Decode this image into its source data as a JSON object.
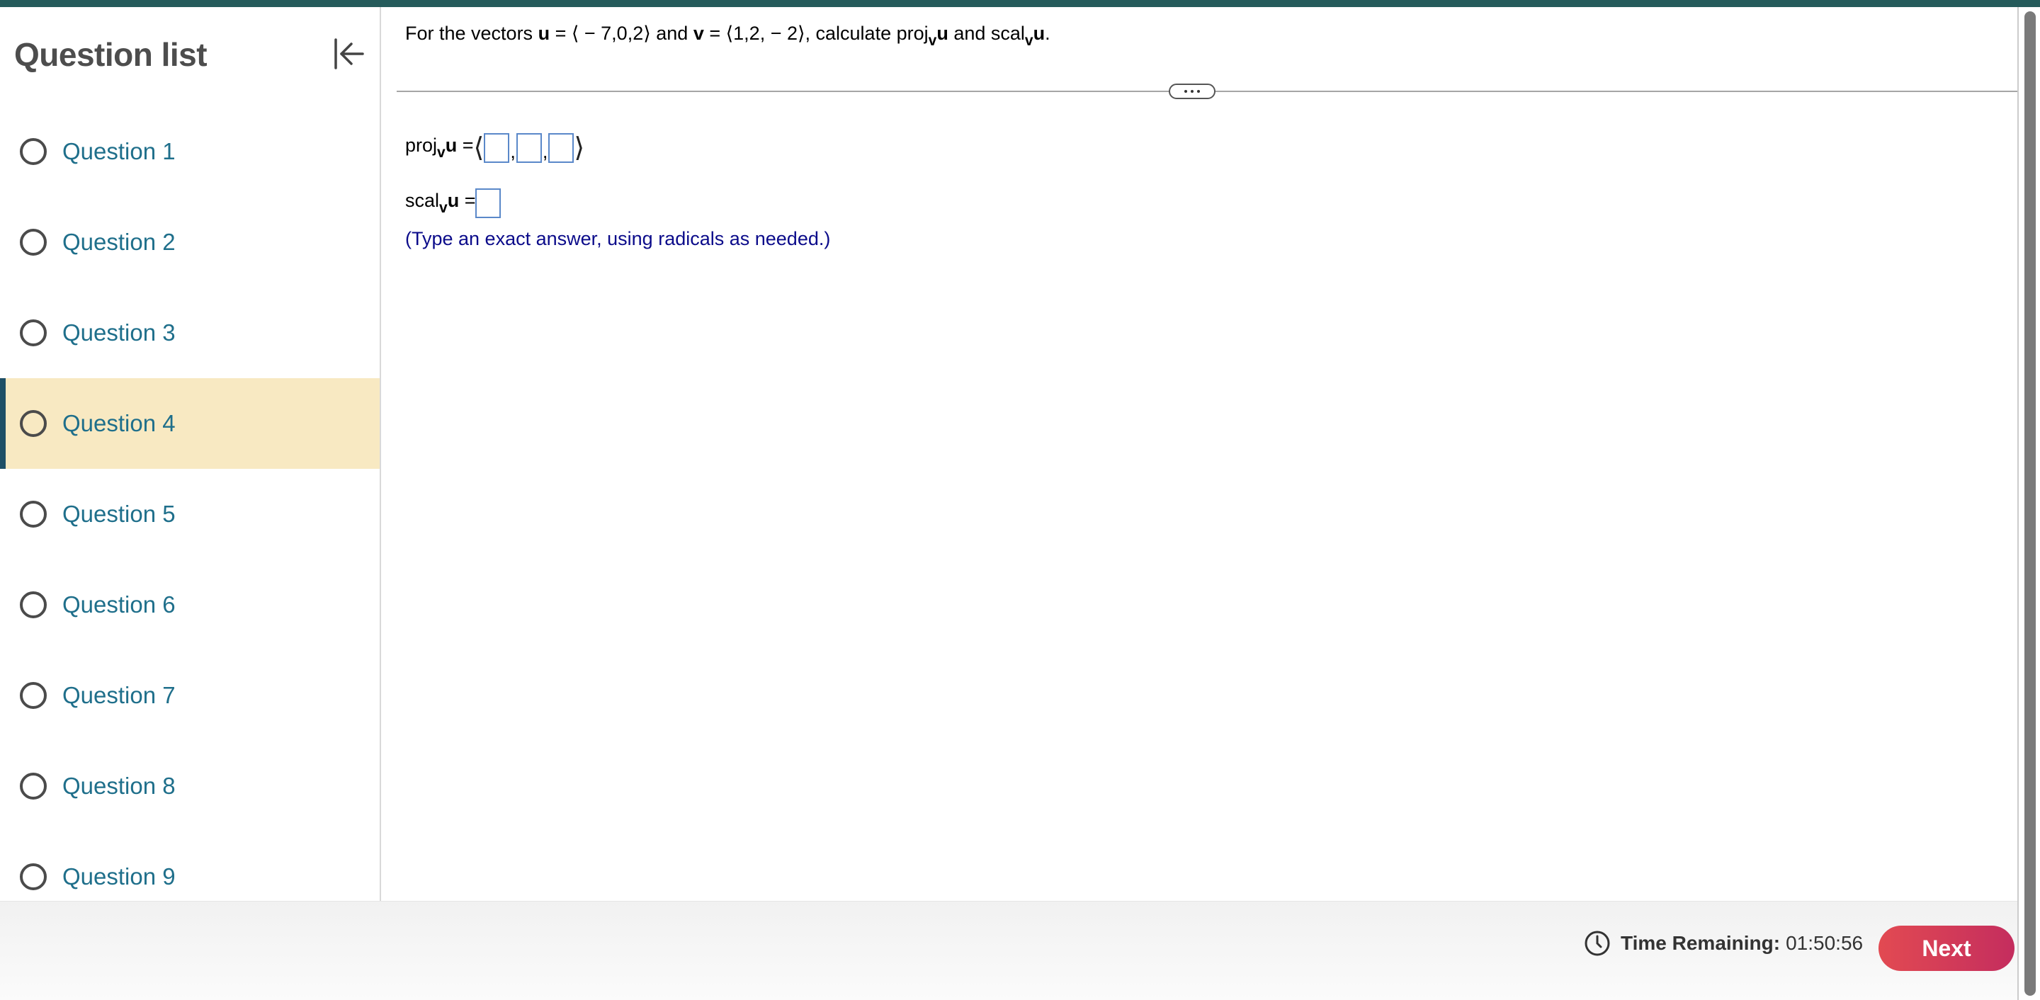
{
  "sidebar": {
    "title": "Question list",
    "collapse_icon": "collapse-left-icon",
    "active_index": 3,
    "items": [
      {
        "label": "Question 1"
      },
      {
        "label": "Question 2"
      },
      {
        "label": "Question 3"
      },
      {
        "label": "Question 4"
      },
      {
        "label": "Question 5"
      },
      {
        "label": "Question 6"
      },
      {
        "label": "Question 7"
      },
      {
        "label": "Question 8"
      },
      {
        "label": "Question 9"
      }
    ]
  },
  "question": {
    "prefix": "For the vectors ",
    "u_symbol": "u",
    "equals": " = ",
    "u_value": "⟨ − 7,0,2⟩",
    "and_text": " and ",
    "v_symbol": "v",
    "v_value": "⟨1,2, − 2⟩",
    "calc_text": ", calculate ",
    "proj_text": "proj",
    "scal_text": "scal",
    "sub_v": "v",
    "end_period": "."
  },
  "answers": {
    "proj_lhs": "proj",
    "scal_lhs": "scal",
    "sub_v": "v",
    "u_symbol": "u",
    "equals": " = ",
    "left_angle": "⟨",
    "right_angle": "⟩",
    "comma": ",",
    "hint": "(Type an exact answer, using radicals as needed.)"
  },
  "footer": {
    "timer_label": "Time Remaining:",
    "timer_value": "01:50:56",
    "clock_icon": "clock-icon",
    "next_label": "Next"
  },
  "colors": {
    "accent_bar": "#255b5b",
    "active_item_bg": "#f8e9c2",
    "link_blue": "#1f6f8b",
    "next_button": "#d63a58",
    "hint_blue": "#0b0b8a"
  }
}
